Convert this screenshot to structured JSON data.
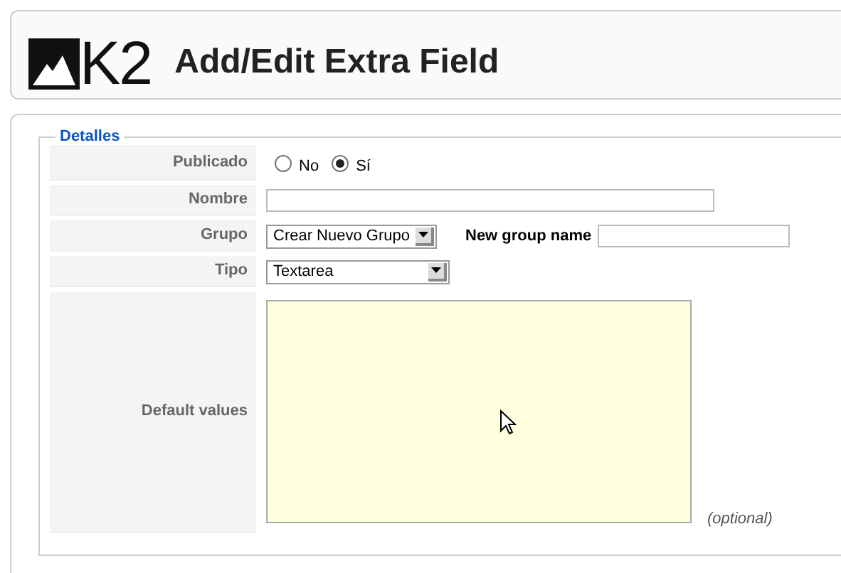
{
  "header": {
    "logo_text": "K2",
    "title": "Add/Edit Extra Field"
  },
  "section": {
    "legend": "Detalles",
    "rows": [
      {
        "kind": "radio",
        "label": "Publicado",
        "options": [
          {
            "label": "No",
            "selected": false
          },
          {
            "label": "Sí",
            "selected": true
          }
        ]
      },
      {
        "kind": "text",
        "label": "Nombre"
      },
      {
        "kind": "select-extra",
        "label": "Grupo",
        "value": "Crear Nuevo Grupo",
        "extra_label": "New group name"
      },
      {
        "kind": "select",
        "label": "Tipo",
        "value": "Textarea"
      },
      {
        "kind": "textarea",
        "label": "Default values",
        "note": "(optional)"
      }
    ]
  }
}
